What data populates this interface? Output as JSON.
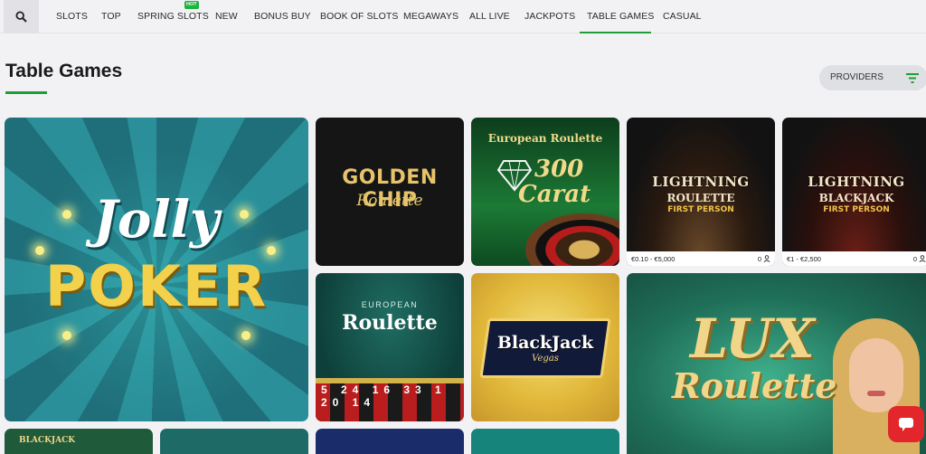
{
  "nav": {
    "items": [
      "SLOTS",
      "TOP",
      "SPRING SLOTS",
      "NEW",
      "BONUS BUY",
      "BOOK OF SLOTS",
      "MEGAWAYS",
      "ALL LIVE",
      "JACKPOTS",
      "TABLE GAMES",
      "CASUAL"
    ],
    "active": "TABLE GAMES",
    "hot_badge": "HOT"
  },
  "page": {
    "title": "Table Games"
  },
  "providers": {
    "label": "PROVIDERS"
  },
  "tiles": {
    "jolly_poker": {
      "line1": "Jolly",
      "line2": "POKER"
    },
    "golden_chip": {
      "line1": "GOLDEN CHIP",
      "line2": "Roulette"
    },
    "carat": {
      "line1": "European Roulette",
      "line2": "300",
      "line3": "Carat"
    },
    "lightning_roulette": {
      "line1": "LIGHTNING",
      "line2": "ROULETTE",
      "line3": "FIRST PERSON",
      "limits": "€0.10 - €5,000",
      "players": "0"
    },
    "lightning_blackjack": {
      "line1": "LIGHTNING",
      "line2": "BLACKJACK",
      "line3": "FIRST PERSON",
      "limits": "€1 - €2,500",
      "players": "0"
    },
    "european_roulette": {
      "line1": "EUROPEAN",
      "line2": "Roulette",
      "numbers": "5 24 16 33 1 20 14"
    },
    "blackjack_vegas": {
      "line1": "BlackJack",
      "line2": "Vegas"
    },
    "lux_roulette": {
      "line1": "LUX",
      "line2": "Roulette"
    },
    "blackjack_bottom": {
      "line1": "BLACKJACK"
    }
  },
  "colors": {
    "accent": "#1f9d3a",
    "hot": "#1db33c",
    "chat": "#e2262b"
  },
  "icons": {
    "search": "search-icon",
    "filter": "filter-icon",
    "player": "player-icon",
    "chat": "chat-icon"
  }
}
